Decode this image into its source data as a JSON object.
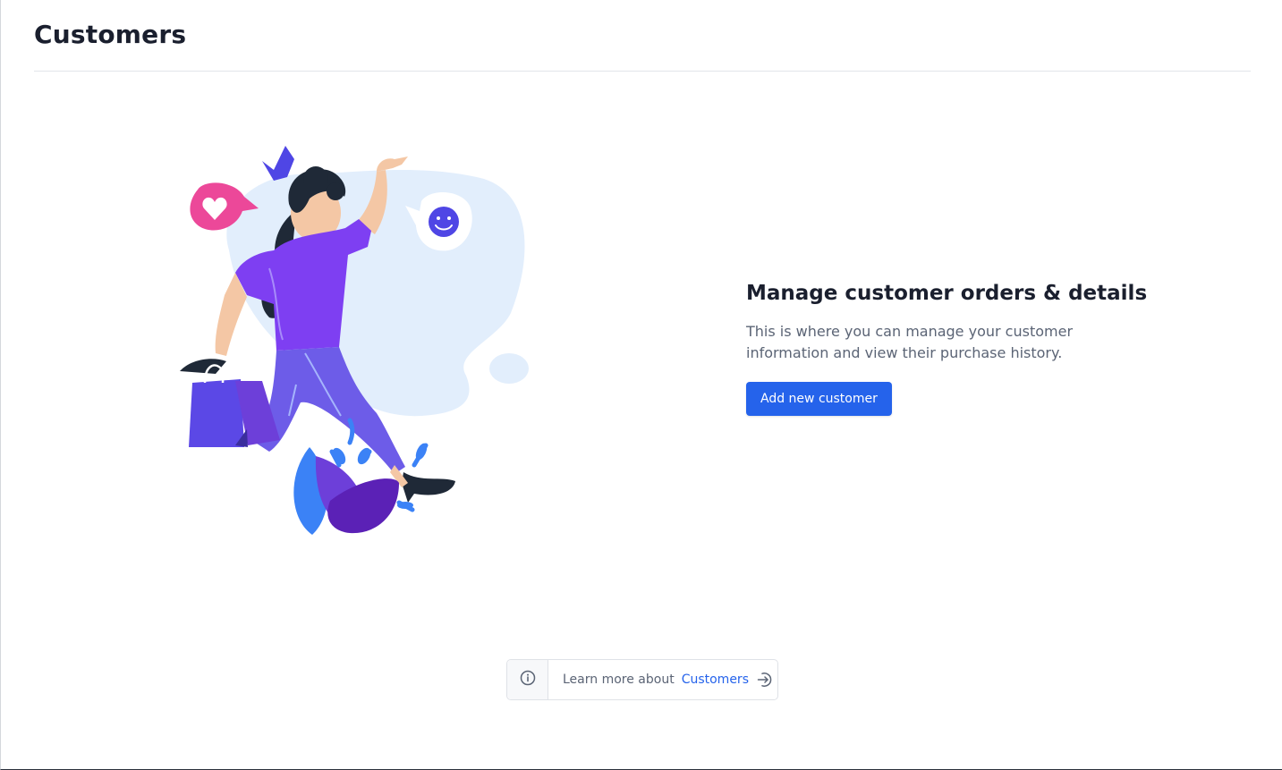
{
  "page": {
    "title": "Customers"
  },
  "empty_state": {
    "heading": "Manage customer orders & details",
    "description": "This is where you can manage your customer information and view their purchase history.",
    "primary_action_label": "Add new customer"
  },
  "learn_more": {
    "prefix": "Learn more about",
    "link_label": "Customers",
    "info_icon": "info-circle-icon",
    "arrow_icon": "arrow-right-circle-icon"
  },
  "colors": {
    "accent": "#2563eb",
    "heading": "#1a1f2e",
    "muted_text": "#5b6475",
    "border": "#dfe2e7"
  }
}
